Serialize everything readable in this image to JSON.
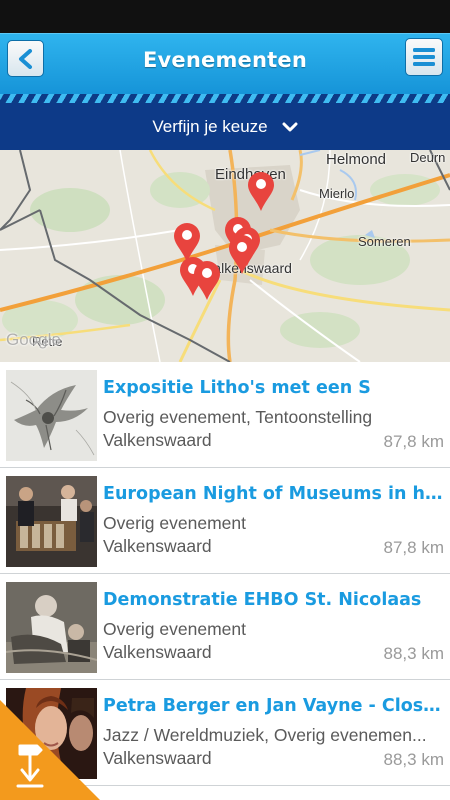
{
  "header": {
    "title": "Evenementen",
    "back_icon": "chevron-left-icon",
    "menu_icon": "hamburger-menu-icon",
    "bar_color": "#1ea5e6"
  },
  "filter": {
    "label": "Verfijn je keuze",
    "icon": "chevron-down-icon",
    "bar_color": "#0d3a88"
  },
  "map": {
    "places": {
      "eindhoven": "Eindhoven",
      "helmond": "Helmond",
      "deurne": "Deurn",
      "mierlo": "Mierlo",
      "someren": "Someren",
      "valkenswaard": "Valkenswaard",
      "retie": "Retie"
    },
    "watermark": "Google",
    "pin_color": "#e8443e"
  },
  "events": [
    {
      "title": "Expositie Litho's met een S",
      "category": "Overig evenement, Tentoonstelling",
      "place": "Valkenswaard",
      "distance": "87,8 km"
    },
    {
      "title": "European Night of Museums in het...",
      "category": "Overig evenement",
      "place": "Valkenswaard",
      "distance": "87,8 km"
    },
    {
      "title": "Demonstratie EHBO St. Nicolaas",
      "category": "Overig evenement",
      "place": "Valkenswaard",
      "distance": "88,3 km"
    },
    {
      "title": "Petra Berger en Jan Vayne - Close...",
      "category": "Jazz / Wereldmuziek, Overig evenemen...",
      "place": "Valkenswaard",
      "distance": "88,3 km"
    }
  ],
  "corner_badge": {
    "icon": "signpost-download-icon",
    "color": "#f39a1d"
  }
}
